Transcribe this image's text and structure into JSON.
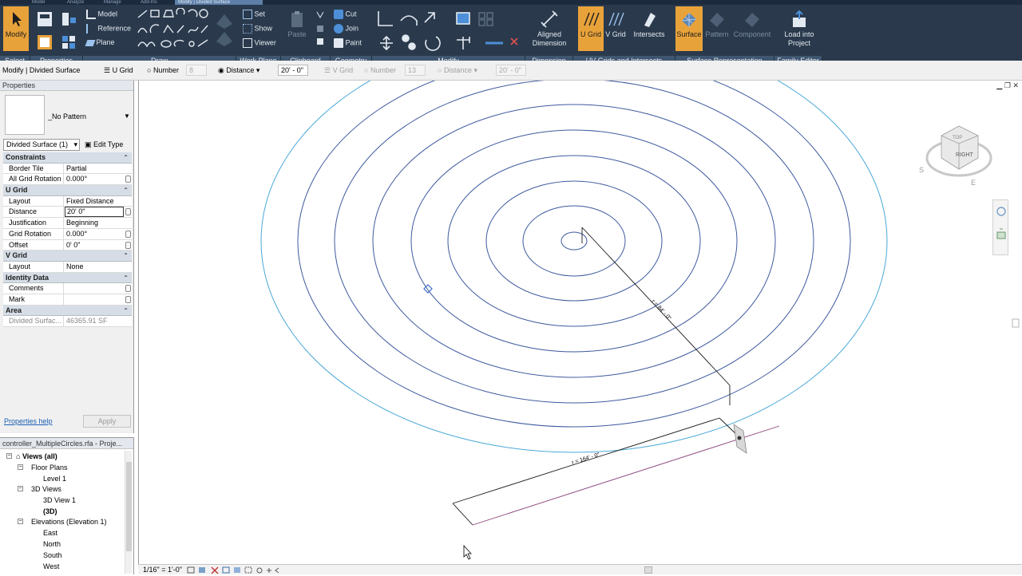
{
  "ribbon_tabs": [
    "Model",
    "Analyze",
    "Manage",
    "Add-Ins",
    "Modify | Divided Surface"
  ],
  "ribbon": {
    "select": {
      "modify_label": "Modify",
      "panel": "Select"
    },
    "properties_panel": "Properties",
    "draw": {
      "model": "Model",
      "reference": "Reference",
      "plane": "Plane",
      "panel": "Draw"
    },
    "workplane": {
      "set": "Set",
      "show": "Show",
      "viewer": "Viewer",
      "panel": "Work Plane"
    },
    "clipboard": {
      "paste": "Paste",
      "panel": "Clipboard"
    },
    "geometry": {
      "cut": "Cut",
      "join": "Join",
      "paint": "Paint",
      "panel": "Geometry"
    },
    "modify_panel": "Modify",
    "dimension": {
      "aligned": "Aligned",
      "aligned2": "Dimension",
      "panel": "Dimension"
    },
    "uvgrids": {
      "ugrid": "U Grid",
      "vgrid": "V Grid",
      "intersects": "Intersects",
      "panel": "UV Grids and Intersects"
    },
    "surface_rep": {
      "surface": "Surface",
      "pattern": "Pattern",
      "component": "Component",
      "panel": "Surface Representation"
    },
    "family_editor": {
      "load": "Load into",
      "load2": "Project",
      "panel": "Family Editor"
    }
  },
  "options_bar": {
    "context": "Modify | Divided Surface",
    "ugrid": "U Grid",
    "number": "Number",
    "number_value": "8",
    "distance": "Distance",
    "distance_value": "20' - 0\"",
    "vgrid": "V Grid",
    "v_number": "Number",
    "v_number_value": "13",
    "v_distance": "Distance",
    "v_distance_value": "20' - 0\""
  },
  "properties": {
    "header": "Properties",
    "type_name": "_No Pattern",
    "instance_selector": "Divided Surface (1)",
    "edit_type": "Edit Type",
    "groups": [
      {
        "name": "Constraints",
        "rows": [
          {
            "k": "Border Tile",
            "v": "Partial"
          },
          {
            "k": "All Grid Rotation",
            "v": "0.000°"
          }
        ]
      },
      {
        "name": "U Grid",
        "rows": [
          {
            "k": "Layout",
            "v": "Fixed Distance"
          },
          {
            "k": "Distance",
            "v": "20'  0\""
          },
          {
            "k": "Justification",
            "v": "Beginning"
          },
          {
            "k": "Grid Rotation",
            "v": "0.000°"
          },
          {
            "k": "Offset",
            "v": "0'  0\""
          }
        ]
      },
      {
        "name": "V Grid",
        "rows": [
          {
            "k": "Layout",
            "v": "None"
          }
        ]
      },
      {
        "name": "Identity Data",
        "rows": [
          {
            "k": "Comments",
            "v": ""
          },
          {
            "k": "Mark",
            "v": ""
          }
        ]
      },
      {
        "name": "Area",
        "rows": [
          {
            "k": "Divided Surfac...",
            "v": "46365.91 SF"
          }
        ]
      }
    ],
    "help": "Properties help",
    "apply": "Apply"
  },
  "browser": {
    "header": "controller_MultipleCircles.rfa - Proje...",
    "items": [
      {
        "label": "Views (all)"
      },
      {
        "label": "Floor Plans"
      },
      {
        "label": "Level 1"
      },
      {
        "label": "3D Views"
      },
      {
        "label": "3D View 1"
      },
      {
        "label": "(3D)"
      },
      {
        "label": "Elevations (Elevation 1)"
      },
      {
        "label": "East"
      },
      {
        "label": "North"
      },
      {
        "label": "South"
      },
      {
        "label": "West"
      }
    ]
  },
  "canvas": {
    "dim_radial": "r = 84' - 0\"",
    "dim_bottom": "r = 164' - 0\"",
    "viewcube_face": "RIGHT",
    "viewcube_top": "TOP",
    "compass_s": "S",
    "compass_e": "E",
    "scale": "1/16\" = 1'-0\""
  },
  "colors": {
    "ribbon_bg": "#2a3a4c",
    "active_tool": "#e8a23a",
    "grid_line": "#3d5a9e"
  }
}
